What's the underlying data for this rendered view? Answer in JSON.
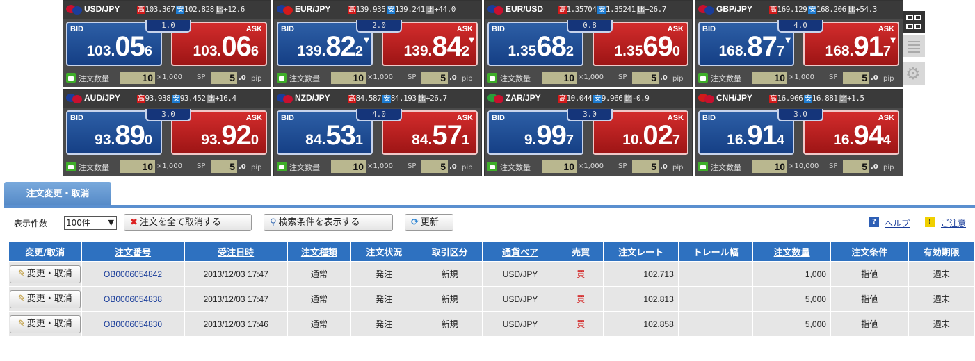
{
  "labels": {
    "high": "高",
    "low": "安",
    "change": "比",
    "bid": "BID",
    "ask": "ASK",
    "qty": "注文数量",
    "sp": "SP",
    "pip": "pip"
  },
  "panels": [
    {
      "pair": "USD/JPY",
      "high": "103.367",
      "low": "102.828",
      "change": "+12.6",
      "spread": "1.0",
      "bid": {
        "pre": "103.",
        "big": "05",
        "pip": "6",
        "arrow": ""
      },
      "ask": {
        "pre": "103.",
        "big": "06",
        "pip": "6",
        "arrow": ""
      },
      "qty": "10",
      "unit": "×1,000",
      "sp": "5",
      "sp_dec": ".0",
      "flag": [
        "#c8102e",
        "#1a3d9a"
      ]
    },
    {
      "pair": "EUR/JPY",
      "high": "139.935",
      "low": "139.241",
      "change": "+44.0",
      "spread": "2.0",
      "bid": {
        "pre": "139.",
        "big": "82",
        "pip": "2",
        "arrow": "▼"
      },
      "ask": {
        "pre": "139.",
        "big": "84",
        "pip": "2",
        "arrow": "▼"
      },
      "qty": "10",
      "unit": "×1,000",
      "sp": "5",
      "sp_dec": ".0",
      "flag": [
        "#1a3d9a",
        "#d21a1a"
      ]
    },
    {
      "pair": "EUR/USD",
      "high": "1.35704",
      "low": "1.35241",
      "change": "+26.7",
      "spread": "0.8",
      "bid": {
        "pre": "1.35",
        "big": "68",
        "pip": "2",
        "arrow": ""
      },
      "ask": {
        "pre": "1.35",
        "big": "69",
        "pip": "0",
        "arrow": ""
      },
      "qty": "10",
      "unit": "×1,000",
      "sp": "5",
      "sp_dec": ".0",
      "flag": [
        "#1a3d9a",
        "#c8102e"
      ]
    },
    {
      "pair": "GBP/JPY",
      "high": "169.129",
      "low": "168.206",
      "change": "+54.3",
      "spread": "4.0",
      "bid": {
        "pre": "168.",
        "big": "87",
        "pip": "7",
        "arrow": "▼"
      },
      "ask": {
        "pre": "168.",
        "big": "91",
        "pip": "7",
        "arrow": "▼"
      },
      "qty": "10",
      "unit": "×1,000",
      "sp": "5",
      "sp_dec": ".0",
      "flag": [
        "#c8102e",
        "#1a3d9a"
      ]
    },
    {
      "pair": "AUD/JPY",
      "high": "93.938",
      "low": "93.452",
      "change": "+16.4",
      "spread": "3.0",
      "bid": {
        "pre": "93.",
        "big": "89",
        "pip": "0",
        "arrow": ""
      },
      "ask": {
        "pre": "93.",
        "big": "92",
        "pip": "0",
        "arrow": ""
      },
      "qty": "10",
      "unit": "×1,000",
      "sp": "5",
      "sp_dec": ".0",
      "flag": [
        "#1a3d9a",
        "#c8102e"
      ]
    },
    {
      "pair": "NZD/JPY",
      "high": "84.587",
      "low": "84.193",
      "change": "+26.7",
      "spread": "4.0",
      "bid": {
        "pre": "84.",
        "big": "53",
        "pip": "1",
        "arrow": ""
      },
      "ask": {
        "pre": "84.",
        "big": "57",
        "pip": "1",
        "arrow": ""
      },
      "qty": "10",
      "unit": "×1,000",
      "sp": "5",
      "sp_dec": ".0",
      "flag": [
        "#1a3d9a",
        "#c8102e"
      ]
    },
    {
      "pair": "ZAR/JPY",
      "high": "10.044",
      "low": "9.966",
      "change": "-0.9",
      "spread": "3.0",
      "bid": {
        "pre": "9.",
        "big": "99",
        "pip": "7",
        "arrow": ""
      },
      "ask": {
        "pre": "10.",
        "big": "02",
        "pip": "7",
        "arrow": ""
      },
      "qty": "10",
      "unit": "×1,000",
      "sp": "5",
      "sp_dec": ".0",
      "flag": [
        "#2a9d3a",
        "#c8102e"
      ]
    },
    {
      "pair": "CNH/JPY",
      "high": "16.966",
      "low": "16.881",
      "change": "+1.5",
      "spread": "3.0",
      "bid": {
        "pre": "16.",
        "big": "91",
        "pip": "4",
        "arrow": ""
      },
      "ask": {
        "pre": "16.",
        "big": "94",
        "pip": "4",
        "arrow": ""
      },
      "qty": "10",
      "unit": "×10,000",
      "sp": "5",
      "sp_dec": ".0",
      "flag": [
        "#d21a1a",
        "#c8102e"
      ]
    }
  ],
  "tab": {
    "label": "注文変更・取消"
  },
  "toolbar": {
    "count_label": "表示件数",
    "count_value": "100件",
    "cancel_all": "注文を全て取消する",
    "search": "検索条件を表示する",
    "refresh": "更新",
    "help": "ヘルプ",
    "notice": "ご注意"
  },
  "table": {
    "headers": [
      "変更/取消",
      "注文番号",
      "受注日時",
      "注文種類",
      "注文状況",
      "取引区分",
      "通貨ペア",
      "売買",
      "注文レート",
      "トレール幅",
      "注文数量",
      "注文条件",
      "有効期限"
    ],
    "edit_label": "変更・取消",
    "rows": [
      [
        "OB0006054842",
        "2013/12/03 17:47",
        "通常",
        "発注",
        "新規",
        "USD/JPY",
        "買",
        "102.713",
        "",
        "1,000",
        "指値",
        "週末"
      ],
      [
        "OB0006054838",
        "2013/12/03 17:47",
        "通常",
        "発注",
        "新規",
        "USD/JPY",
        "買",
        "102.813",
        "",
        "5,000",
        "指値",
        "週末"
      ],
      [
        "OB0006054830",
        "2013/12/03 17:46",
        "通常",
        "発注",
        "新規",
        "USD/JPY",
        "買",
        "102.858",
        "",
        "5,000",
        "指値",
        "週末"
      ]
    ]
  },
  "colors": {
    "bid": "#1d4a94",
    "ask": "#b51e1e",
    "header": "#2e71c0",
    "tab": "#5a8fcf"
  }
}
